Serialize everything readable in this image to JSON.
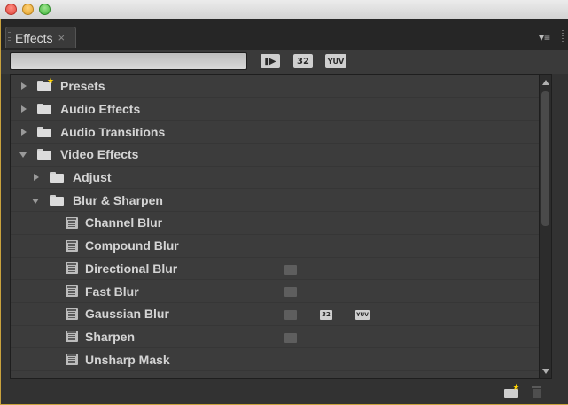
{
  "panel": {
    "tab_label": "Effects",
    "tab_close": "×",
    "menu_glyph": "▾≡"
  },
  "toolbar": {
    "search_value": "",
    "search_placeholder": "",
    "badge_accelerated": "▮▶",
    "badge_32": "32",
    "badge_yuv": "YUV"
  },
  "tree": {
    "presets": "Presets",
    "audio_effects": "Audio Effects",
    "audio_transitions": "Audio Transitions",
    "video_effects": "Video Effects",
    "adjust": "Adjust",
    "blur_sharpen": "Blur & Sharpen",
    "channel_blur": "Channel Blur",
    "compound_blur": "Compound Blur",
    "directional_blur": "Directional Blur",
    "fast_blur": "Fast Blur",
    "gaussian_blur": "Gaussian Blur",
    "sharpen": "Sharpen",
    "unsharp_mask": "Unsharp Mask",
    "mini_32": "32",
    "mini_yuv": "YUV"
  },
  "colors": {
    "accent_star": "#ffd400",
    "panel_bg": "#323232",
    "tree_bg": "#3c3c3c"
  }
}
